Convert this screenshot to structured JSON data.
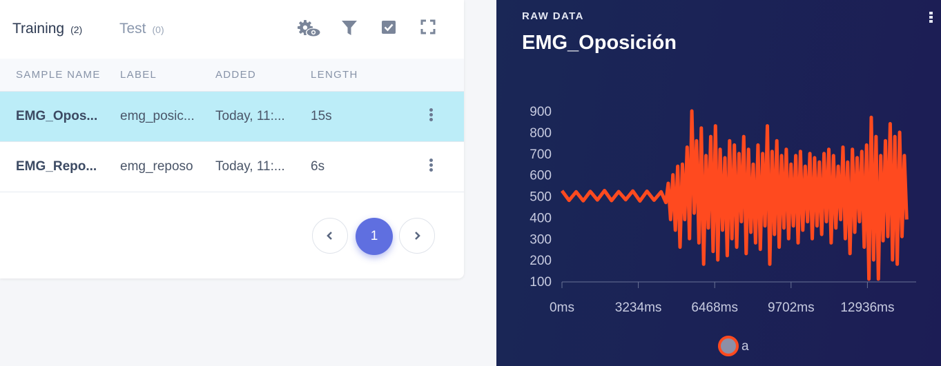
{
  "tabs": [
    {
      "label": "Training",
      "count": "(2)"
    },
    {
      "label": "Test",
      "count": "(0)"
    }
  ],
  "toolbar_icons": [
    "settings-eye-icon",
    "filter-icon",
    "checkbox-icon",
    "fullscreen-icon"
  ],
  "table": {
    "columns": [
      "SAMPLE NAME",
      "LABEL",
      "ADDED",
      "LENGTH"
    ],
    "rows": [
      {
        "name": "EMG_Opos...",
        "label": "emg_posic...",
        "added": "Today, 11:...",
        "length": "15s",
        "selected": true
      },
      {
        "name": "EMG_Repo...",
        "label": "emg_reposo",
        "added": "Today, 11:...",
        "length": "6s",
        "selected": false
      }
    ]
  },
  "pagination": {
    "current": "1",
    "prev_icon": "chevron-left-icon",
    "next_icon": "chevron-right-icon"
  },
  "raw_data": {
    "eyebrow": "RAW DATA",
    "title": "EMG_Oposición",
    "menu_icon": "more-vertical-icon"
  },
  "colors": {
    "accent": "#5f6fe0",
    "selected_row": "#bcedf8",
    "panel_bg": "#1b2256",
    "series": "#ff4a1f"
  },
  "chart_data": {
    "type": "line",
    "title": "",
    "xlabel": "",
    "ylabel": "",
    "xlim": [
      0,
      15000
    ],
    "ylim": [
      100,
      900
    ],
    "x_ticks": [
      "0ms",
      "3234ms",
      "6468ms",
      "9702ms",
      "12936ms"
    ],
    "x_tick_values": [
      0,
      3234,
      6468,
      9702,
      12936
    ],
    "y_ticks": [
      "100",
      "200",
      "300",
      "400",
      "500",
      "600",
      "700",
      "800",
      "900"
    ],
    "y_tick_values": [
      100,
      200,
      300,
      400,
      500,
      600,
      700,
      800,
      900
    ],
    "grid": false,
    "legend": "bottom-center",
    "series": [
      {
        "name": "a",
        "color": "#ff4a1f",
        "x": [
          0,
          300,
          600,
          900,
          1200,
          1500,
          1800,
          2100,
          2400,
          2700,
          3000,
          3300,
          3600,
          3900,
          4200,
          4400,
          4500,
          4600,
          4700,
          4800,
          4900,
          5000,
          5100,
          5200,
          5300,
          5400,
          5500,
          5600,
          5700,
          5800,
          5900,
          6000,
          6100,
          6200,
          6300,
          6400,
          6500,
          6600,
          6700,
          6800,
          6900,
          7000,
          7100,
          7200,
          7300,
          7400,
          7500,
          7600,
          7700,
          7800,
          7900,
          8000,
          8100,
          8200,
          8300,
          8400,
          8500,
          8600,
          8700,
          8800,
          8900,
          9000,
          9100,
          9200,
          9300,
          9400,
          9500,
          9600,
          9700,
          9800,
          9900,
          10000,
          10100,
          10200,
          10300,
          10400,
          10500,
          10600,
          10700,
          10800,
          10900,
          11000,
          11100,
          11200,
          11300,
          11400,
          11500,
          11600,
          11700,
          11800,
          11900,
          12000,
          12100,
          12200,
          12300,
          12400,
          12500,
          12600,
          12700,
          12800,
          12900,
          13000,
          13100,
          13200,
          13300,
          13400,
          13500,
          13600,
          13700,
          13800,
          13900,
          14000,
          14100,
          14200,
          14300,
          14400,
          14500,
          14600
        ],
        "y": [
          525,
          480,
          520,
          478,
          522,
          482,
          526,
          479,
          521,
          483,
          524,
          477,
          523,
          481,
          520,
          470,
          560,
          390,
          600,
          340,
          640,
          260,
          650,
          390,
          730,
          300,
          900,
          420,
          760,
          280,
          820,
          180,
          690,
          350,
          780,
          240,
          830,
          200,
          720,
          340,
          680,
          220,
          760,
          300,
          740,
          260,
          700,
          380,
          780,
          230,
          720,
          330,
          650,
          280,
          740,
          250,
          700,
          360,
          830,
          180,
          710,
          320,
          760,
          260,
          690,
          350,
          720,
          300,
          650,
          360,
          690,
          280,
          710,
          340,
          640,
          380,
          700,
          300,
          680,
          360,
          660,
          320,
          700,
          380,
          720,
          280,
          690,
          350,
          640,
          390,
          730,
          300,
          660,
          230,
          720,
          330,
          680,
          380,
          710,
          260,
          740,
          110,
          870,
          200,
          780,
          110,
          690,
          290,
          760,
          310,
          840,
          200,
          780,
          180,
          800,
          310,
          690,
          390
        ]
      }
    ]
  }
}
